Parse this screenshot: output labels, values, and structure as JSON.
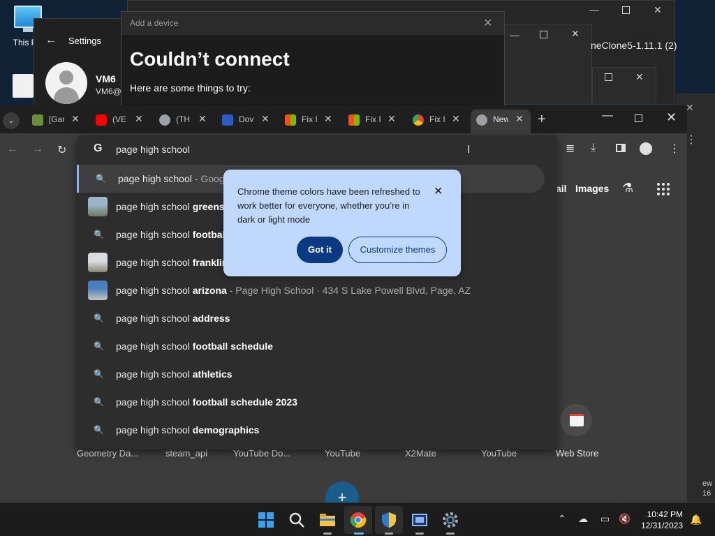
{
  "desktop": {
    "icon_label": "This PC"
  },
  "settings": {
    "title": "Settings",
    "back": "←",
    "user_name": "VM6",
    "user_email": "VM6@"
  },
  "add_device": {
    "title": "Add a device",
    "close": "✕",
    "heading": "Couldn’t connect",
    "subtext": "Here are some things to try:"
  },
  "background_window": {
    "title_fragment": "neClone5-1.11.1 (2)",
    "minimize": "—",
    "close": "✕"
  },
  "chrome": {
    "tabs": [
      {
        "title": "[Gar",
        "icon": "game-icon",
        "color": "#6a8f3a"
      },
      {
        "title": "(VE",
        "icon": "youtube-icon",
        "color": "#ff0000"
      },
      {
        "title": "(TH",
        "icon": "globe-icon",
        "color": "#9aa0a6"
      },
      {
        "title": "Dov",
        "icon": "v-icon",
        "color": "#2c5cc5"
      },
      {
        "title": "Fix I",
        "icon": "microsoft-icon",
        "color": "#f25022"
      },
      {
        "title": "Fix I",
        "icon": "microsoft-icon",
        "color": "#f25022"
      },
      {
        "title": "Fix I",
        "icon": "chrome-icon",
        "color": "#4285f4"
      },
      {
        "title": "New",
        "icon": "chrome-icon",
        "color": "#9aa0a6"
      }
    ],
    "tab_close": "✕",
    "tab_dropdown": "⌄",
    "new_tab": "+",
    "window_min": "—",
    "window_close": "✕",
    "nav_back": "←",
    "nav_forward": "→",
    "reload": "↻",
    "omnibox": {
      "g_logo": "G",
      "query": "page high school",
      "suggestions": [
        {
          "type": "search",
          "base": "page high school",
          "bold": "",
          "dim": " - Google Search",
          "selected": true
        },
        {
          "type": "image",
          "base": "page high school ",
          "bold": "greensboro",
          "dim": ""
        },
        {
          "type": "search",
          "base": "page high school ",
          "bold": "football",
          "dim": ""
        },
        {
          "type": "image",
          "base": "page high school ",
          "bold": "franklin",
          "dim": ""
        },
        {
          "type": "image",
          "base": "page high school ",
          "bold": "arizona",
          "dim": " - Page High School · 434 S Lake Powell Blvd, Page, AZ"
        },
        {
          "type": "search",
          "base": "page high school ",
          "bold": "address",
          "dim": ""
        },
        {
          "type": "search",
          "base": "page high school ",
          "bold": "football schedule",
          "dim": ""
        },
        {
          "type": "search",
          "base": "page high school ",
          "bold": "athletics",
          "dim": ""
        },
        {
          "type": "search",
          "base": "page high school ",
          "bold": "football schedule 2023",
          "dim": ""
        },
        {
          "type": "search",
          "base": "page high school ",
          "bold": "demographics",
          "dim": ""
        }
      ],
      "search_glyph": "🔍"
    },
    "ntp": {
      "gmail": "ail",
      "images": "Images",
      "flask": "⚗",
      "shortcuts": [
        "Geometry Da...",
        "steam_api",
        "YouTube Do...",
        "YouTube",
        "X2Mate",
        "YouTube",
        "Web Store"
      ],
      "fab": "+"
    },
    "callout": {
      "message": "Chrome theme colors have been refreshed to work better for everyone, whether you’re in dark or light mode",
      "close": "✕",
      "got_it": "Got it",
      "customize": "Customize themes"
    }
  },
  "taskbar": {
    "time": "10:42 PM",
    "date": "12/31/2023",
    "tray_chevron": "⌃",
    "bell": "🔔"
  },
  "side_fragment": "ew\n16"
}
